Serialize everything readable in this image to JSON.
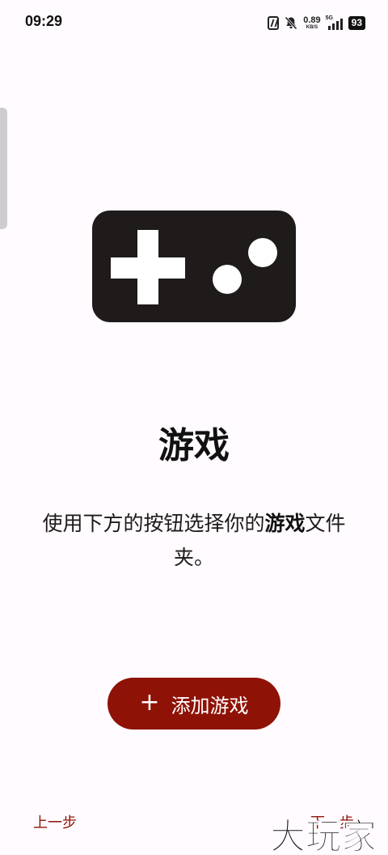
{
  "status_bar": {
    "time": "09:29",
    "net_speed": "0.89",
    "net_unit": "KB/S",
    "network_type": "5G",
    "battery": "93"
  },
  "main": {
    "icon": "gamepad-icon",
    "title": "游戏",
    "description_before": "使用下方的按钮选择你的",
    "description_bold": "游戏",
    "description_after": "文件夹。"
  },
  "add_button": {
    "icon": "plus-icon",
    "icon_glyph": "+",
    "label": "添加游戏"
  },
  "nav": {
    "prev_label": "上一步",
    "next_label": "下一步"
  },
  "watermark": {
    "text": "大玩家"
  },
  "colors": {
    "accent": "#8f1207",
    "background": "#fffbff",
    "text": "#1e1a1a"
  }
}
